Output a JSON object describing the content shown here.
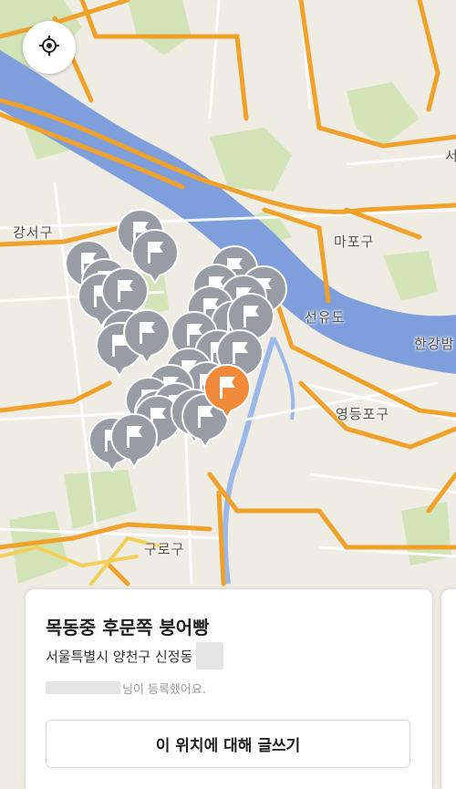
{
  "map": {
    "labels": {
      "gangseo": "강서구",
      "mapo": "마포구",
      "seonyudo": "선유도",
      "hangang": "한강밤",
      "yeongdeungpo": "영등포구",
      "guro": "구로구",
      "edge": "서"
    },
    "colors": {
      "land": "#efece4",
      "river": "#7f9fdc",
      "road_major": "#f0a12a",
      "pin_gray": "#989ca4",
      "pin_selected": "#f08a3a"
    }
  },
  "controls": {
    "locate_icon": "crosshair-icon"
  },
  "card": {
    "title": "목동중 후문쪽 붕어빵",
    "address": "서울특별시 양천구 신정동",
    "registered_suffix": "님이 등록했어요.",
    "write_button": "이 위치에 대해 글쓰기"
  }
}
